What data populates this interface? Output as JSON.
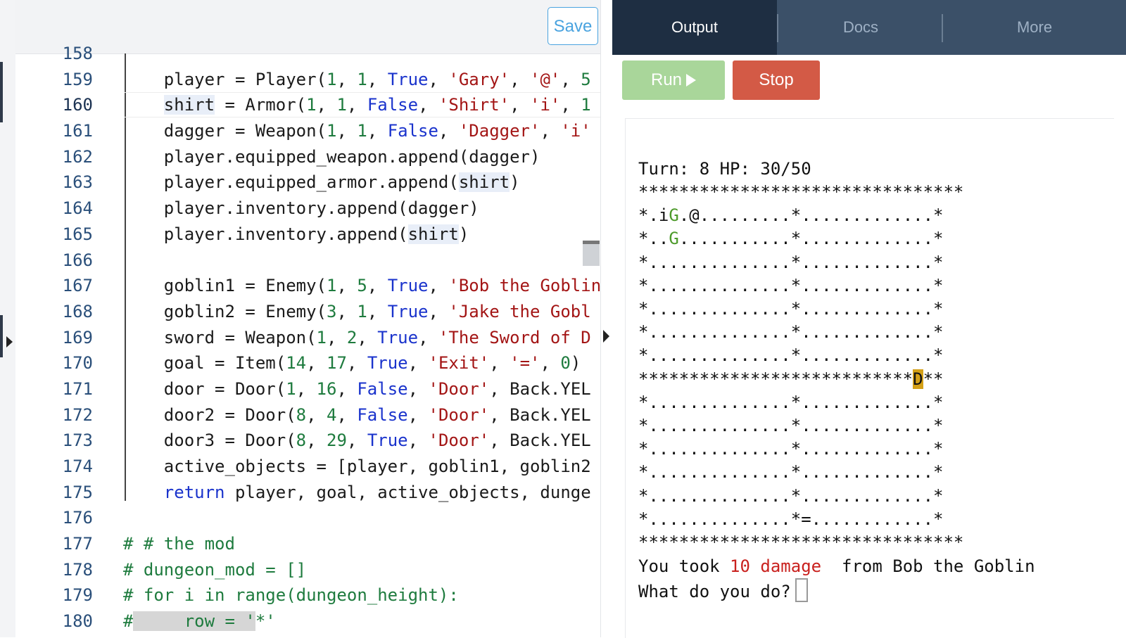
{
  "editor": {
    "save_label": "Save",
    "lines": [
      {
        "n": "158",
        "html": ""
      },
      {
        "n": "159",
        "html": "    player = Player(<span class=\"num\">1</span>, <span class=\"num\">1</span>, <span class=\"kw-t\">True</span>, <span class=\"str\">'Gary'</span>, <span class=\"str\">'@'</span>, <span class=\"num\">5</span>"
      },
      {
        "n": "160",
        "html": "    <span class=\"hl\">shirt</span> = Armor(<span class=\"num\">1</span>, <span class=\"num\">1</span>, <span class=\"kw-t\">False</span>, <span class=\"str\">'Shirt'</span>, <span class=\"str\">'i'</span>, <span class=\"num\">1</span>"
      },
      {
        "n": "161",
        "html": "    dagger = Weapon(<span class=\"num\">1</span>, <span class=\"num\">1</span>, <span class=\"kw-t\">False</span>, <span class=\"str\">'Dagger'</span>, <span class=\"str\">'i'</span>"
      },
      {
        "n": "162",
        "html": "    player.equipped_weapon.append(dagger)"
      },
      {
        "n": "163",
        "html": "    player.equipped_armor.append(<span class=\"hl\">shirt</span>)"
      },
      {
        "n": "164",
        "html": "    player.inventory.append(dagger)"
      },
      {
        "n": "165",
        "html": "    player.inventory.append(<span class=\"hl\">shirt</span>)"
      },
      {
        "n": "166",
        "html": ""
      },
      {
        "n": "167",
        "html": "    goblin1 = Enemy(<span class=\"num\">1</span>, <span class=\"num\">5</span>, <span class=\"kw-t\">True</span>, <span class=\"str\">'Bob the Goblin</span>"
      },
      {
        "n": "168",
        "html": "    goblin2 = Enemy(<span class=\"num\">3</span>, <span class=\"num\">1</span>, <span class=\"kw-t\">True</span>, <span class=\"str\">'Jake the Gobl</span>"
      },
      {
        "n": "169",
        "html": "    sword = Weapon(<span class=\"num\">1</span>, <span class=\"num\">2</span>, <span class=\"kw-t\">True</span>, <span class=\"str\">'The Sword of D</span>"
      },
      {
        "n": "170",
        "html": "    goal = Item(<span class=\"num\">14</span>, <span class=\"num\">17</span>, <span class=\"kw-t\">True</span>, <span class=\"str\">'Exit'</span>, <span class=\"str\">'='</span>, <span class=\"num\">0</span>)"
      },
      {
        "n": "171",
        "html": "    door = Door(<span class=\"num\">1</span>, <span class=\"num\">16</span>, <span class=\"kw-t\">False</span>, <span class=\"str\">'Door'</span>, Back.YEL"
      },
      {
        "n": "172",
        "html": "    door2 = Door(<span class=\"num\">8</span>, <span class=\"num\">4</span>, <span class=\"kw-t\">False</span>, <span class=\"str\">'Door'</span>, Back.YEL"
      },
      {
        "n": "173",
        "html": "    door3 = Door(<span class=\"num\">8</span>, <span class=\"num\">29</span>, <span class=\"kw-t\">True</span>, <span class=\"str\">'Door'</span>, Back.YEL"
      },
      {
        "n": "174",
        "html": "    active_objects = [player, goblin1, goblin2"
      },
      {
        "n": "175",
        "html": "    <span class=\"kw-t\">return</span> player, goal, active_objects, dunge"
      },
      {
        "n": "176",
        "html": ""
      },
      {
        "n": "177",
        "html": "<span class=\"cmt\"># # the mod</span>"
      },
      {
        "n": "178",
        "html": "<span class=\"cmt\"># dungeon_mod = []</span>"
      },
      {
        "n": "179",
        "html": "<span class=\"cmt\"># for i in range(dungeon_height):</span>"
      },
      {
        "n": "180",
        "html": "<span class=\"cmt\">#<span class=\"hl2\">     row = '</span>*'</span>"
      }
    ]
  },
  "tabs": {
    "output": "Output",
    "docs": "Docs",
    "more": "More"
  },
  "controls": {
    "run_label": "Run",
    "stop_label": "Stop"
  },
  "console": {
    "status": "Turn: 8 HP: 30/50",
    "map": [
      "********************************",
      "*.i<span class=\"g\">G</span>.@.........*.............*",
      "*..<span class=\"g\">G</span>...........*.............*",
      "*..............*.............*",
      "*..............*.............*",
      "*..............*.............*",
      "*..............*.............*",
      "*..............*.............*",
      "***************************<span class=\"door\">D</span>**",
      "*..............*.............*",
      "*..............*.............*",
      "*..............*.............*",
      "*..............*.............*",
      "*..............*.............*",
      "*..............*=............*",
      "********************************"
    ],
    "msg_prefix": "You took ",
    "msg_damage": "10 damage",
    "msg_suffix": "  from Bob the Goblin",
    "prompt": "What do you do?"
  }
}
